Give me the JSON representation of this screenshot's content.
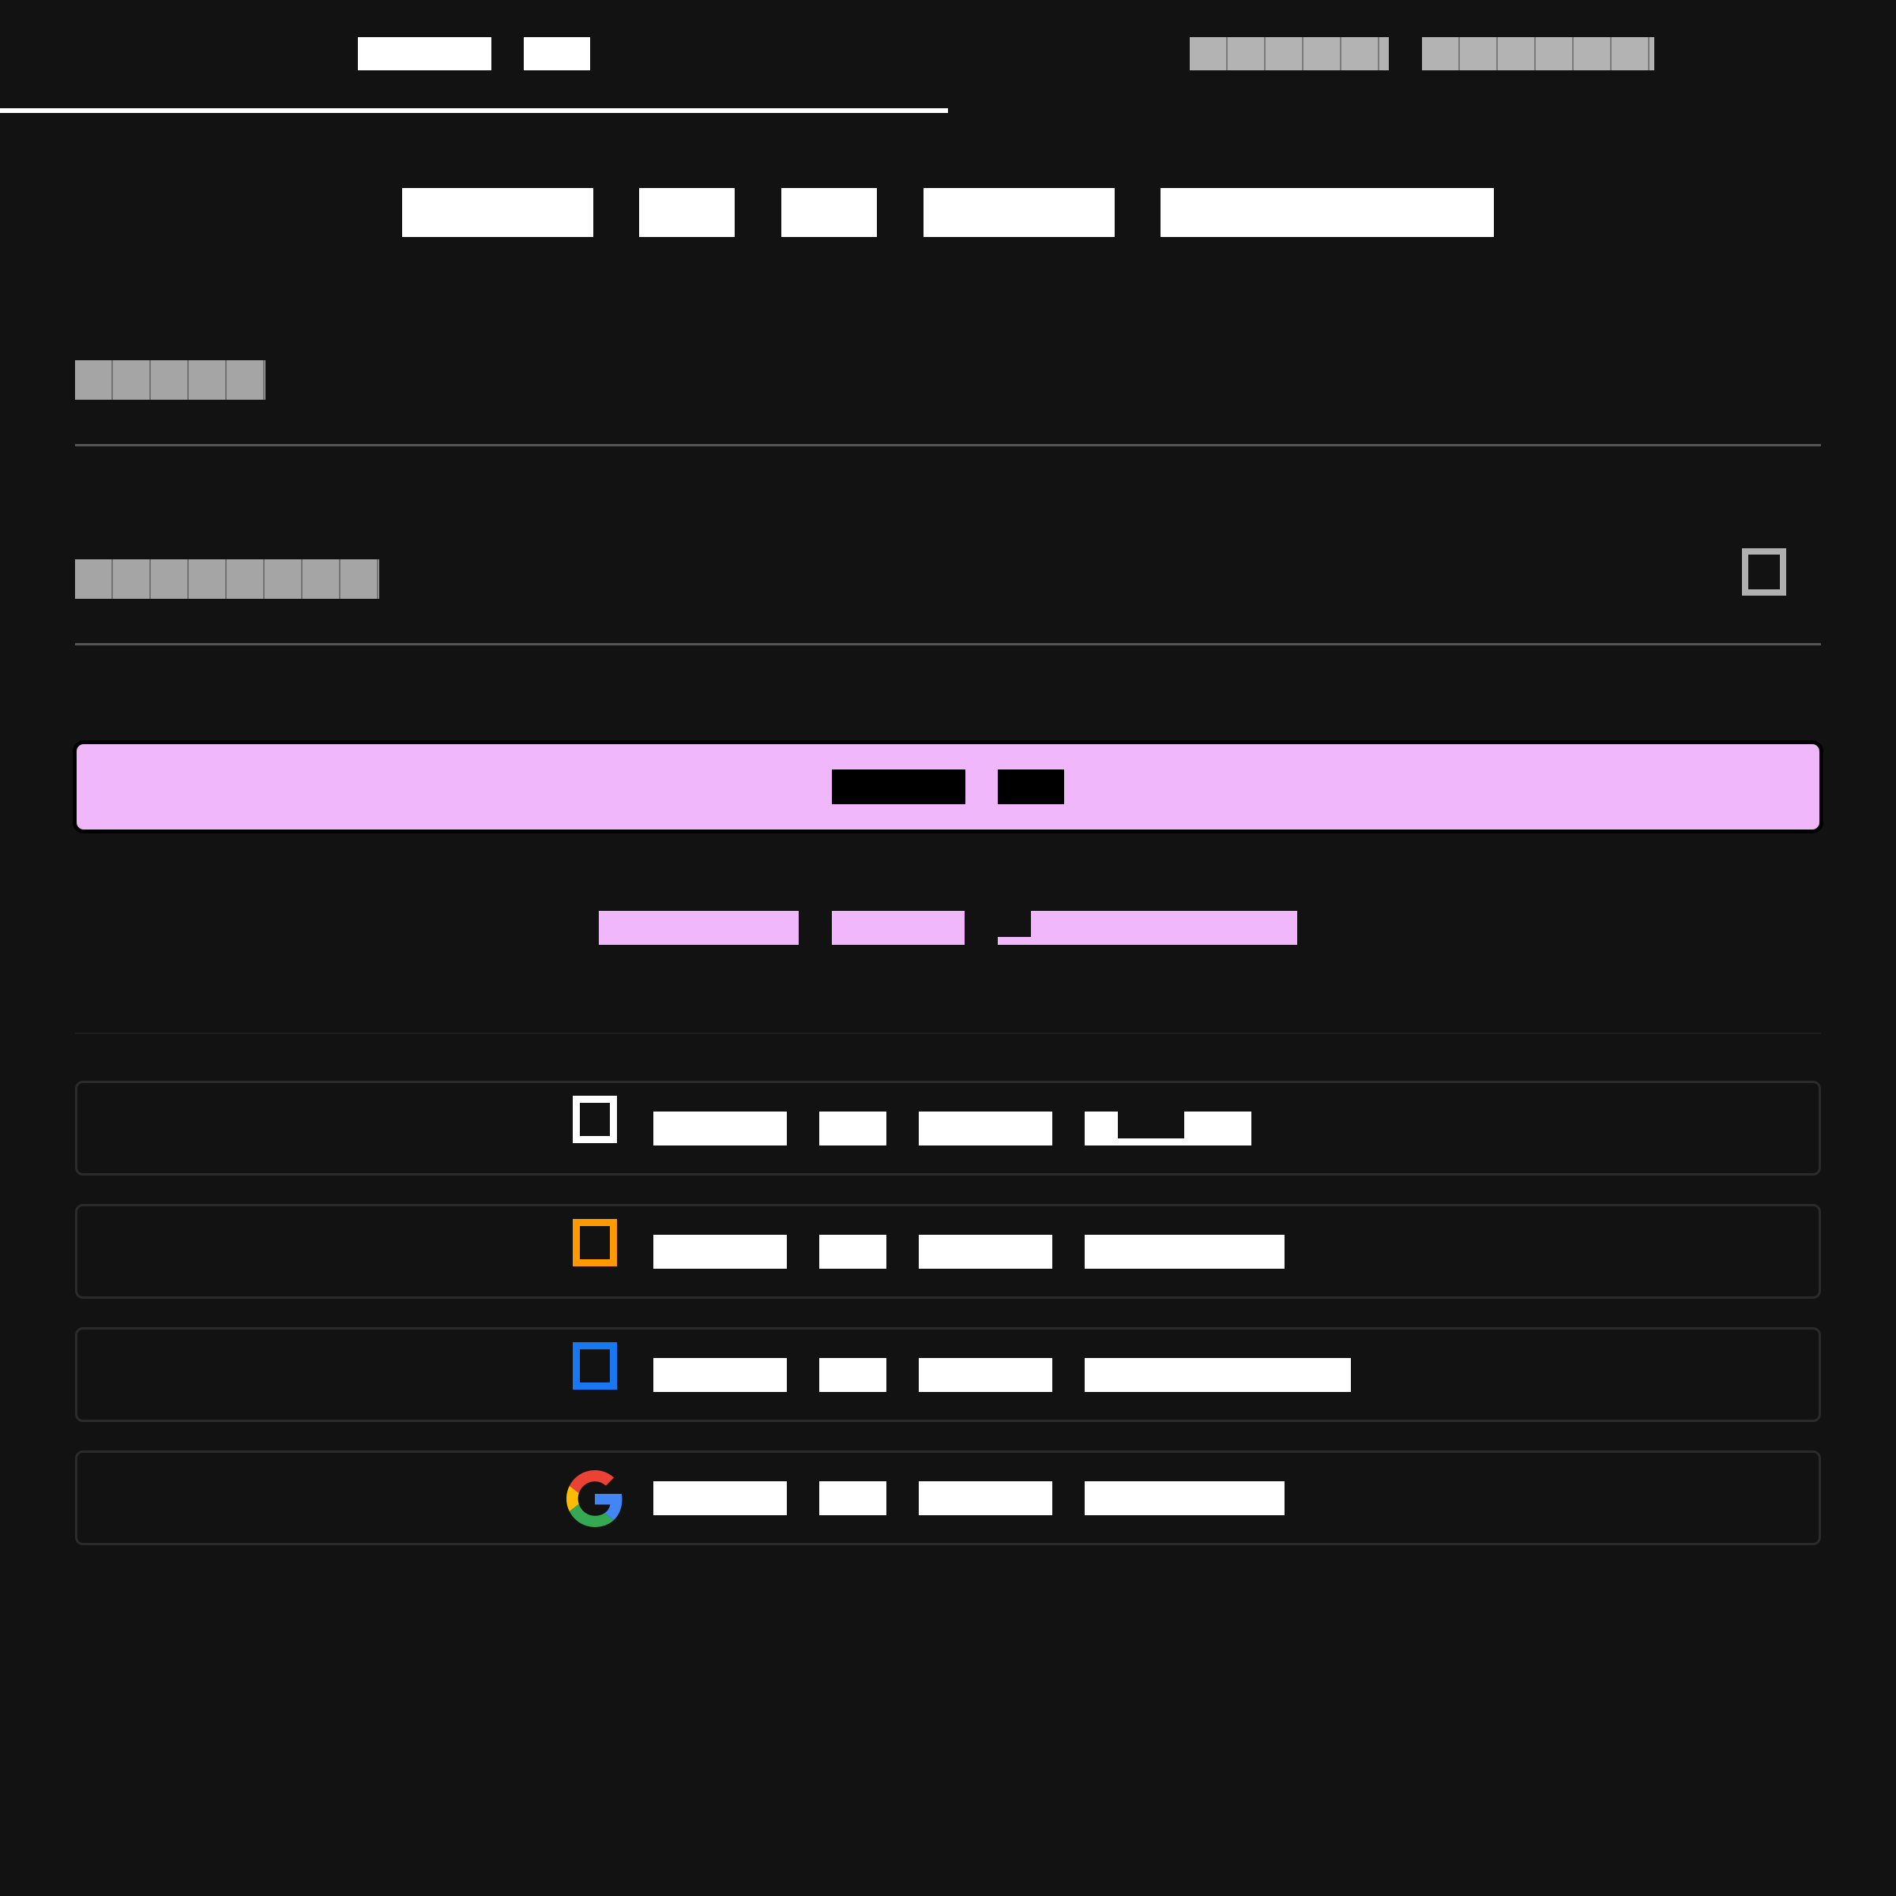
{
  "tabs": [
    {
      "label": "",
      "active": true
    },
    {
      "label": "",
      "active": false
    }
  ],
  "nav": {
    "items": [
      "",
      "",
      "",
      "",
      ""
    ]
  },
  "form": {
    "username": {
      "placeholder": "",
      "value": ""
    },
    "password": {
      "placeholder": "",
      "value": ""
    },
    "submit_label": "",
    "helper_link": ""
  },
  "social": [
    {
      "label": "",
      "icon": "apple-icon"
    },
    {
      "label": "",
      "icon": "amazon-icon"
    },
    {
      "label": "",
      "icon": "facebook-icon"
    },
    {
      "label": "",
      "icon": "google-icon"
    }
  ],
  "colors": {
    "background": "#121212",
    "accent": "#f0b8fb",
    "text": "#ffffff",
    "muted": "#a5a5a5",
    "amazon": "#ff9900",
    "facebook": "#1877f2"
  }
}
